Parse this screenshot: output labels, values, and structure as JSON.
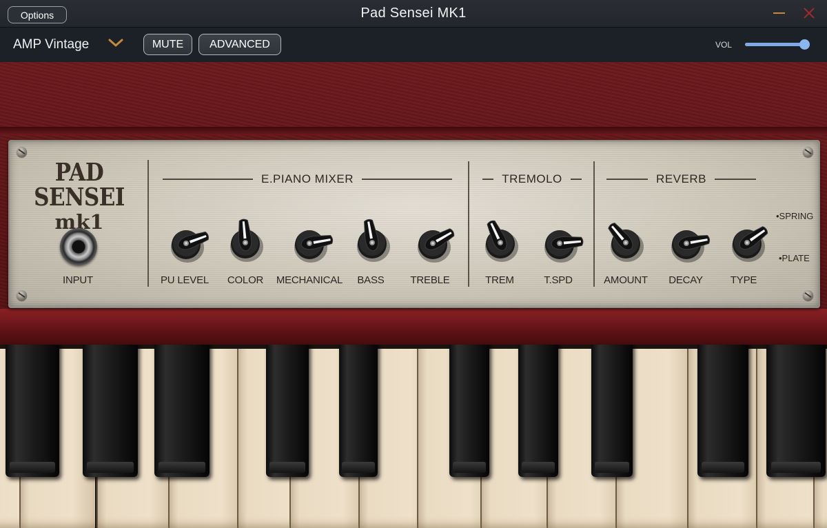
{
  "window": {
    "options_label": "Options",
    "title": "Pad Sensei MK1",
    "accent": "#c48a3d",
    "close_color": "#a8292a"
  },
  "toolbar": {
    "preset_name": "AMP Vintage",
    "mute_label": "MUTE",
    "advanced_label": "ADVANCED",
    "vol_label": "VOL",
    "volume": 0.96
  },
  "panel": {
    "logo_line1": "PAD SENSEI",
    "logo_line2": "mk1",
    "input_label": "INPUT",
    "sections": {
      "mixer": "E.PIANO MIXER",
      "tremolo": "TREMOLO",
      "reverb": "REVERB"
    },
    "knobs": [
      {
        "label": "PU LEVEL",
        "angle": 70
      },
      {
        "label": "COLOR",
        "angle": -5
      },
      {
        "label": "MECHANICAL",
        "angle": 80
      },
      {
        "label": "BASS",
        "angle": -10
      },
      {
        "label": "TREBLE",
        "angle": 60
      },
      {
        "label": "TREM",
        "angle": -25
      },
      {
        "label": "T.SPD",
        "angle": 85
      },
      {
        "label": "AMOUNT",
        "angle": -40
      },
      {
        "label": "DECAY",
        "angle": 80
      },
      {
        "label": "TYPE",
        "angle": 55
      }
    ],
    "type_options": [
      "•SPRING",
      "•PLATE"
    ]
  },
  "keyboard": {
    "white_key": "#eee0c9",
    "black_key": "#111111"
  }
}
